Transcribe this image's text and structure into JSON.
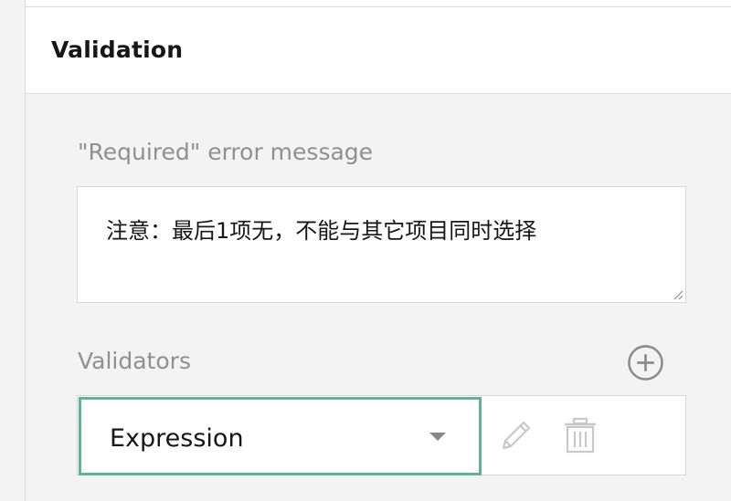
{
  "section": {
    "title": "Validation"
  },
  "required_message": {
    "label": "\"Required\" error message",
    "value": "注意：最后1项无，不能与其它项目同时选择"
  },
  "validators": {
    "label": "Validators",
    "add_icon": "plus-circle-icon",
    "items": [
      {
        "type": "Expression",
        "dropdown_icon": "caret-down-icon",
        "edit_icon": "pencil-icon",
        "delete_icon": "trash-icon"
      }
    ]
  },
  "colors": {
    "accent_border": "#5fb495",
    "muted_text": "#909090",
    "panel_bg": "#f3f3f3",
    "icon_gray": "#c8c8c8"
  }
}
